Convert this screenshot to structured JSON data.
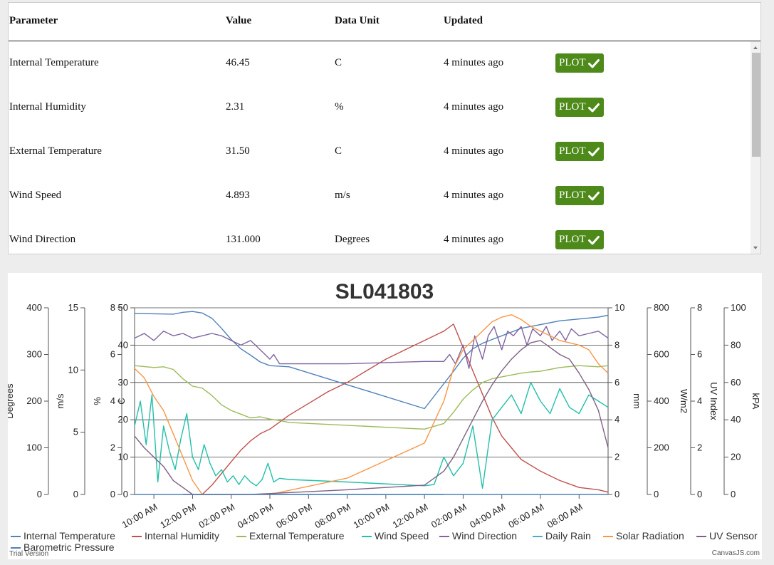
{
  "table": {
    "headers": [
      "Parameter",
      "Value",
      "Data Unit",
      "Updated"
    ],
    "button_label": "PLOT",
    "button_color": "#4e8a1a",
    "button_icon": "check-icon",
    "rows": [
      {
        "parameter": "Internal Temperature",
        "value": "46.45",
        "unit": "C",
        "updated": "4 minutes ago"
      },
      {
        "parameter": "Internal Humidity",
        "value": "2.31",
        "unit": "%",
        "updated": "4 minutes ago"
      },
      {
        "parameter": "External Temperature",
        "value": "31.50",
        "unit": "C",
        "updated": "4 minutes ago"
      },
      {
        "parameter": "Wind Speed",
        "value": "4.893",
        "unit": "m/s",
        "updated": "4 minutes ago"
      },
      {
        "parameter": "Wind Direction",
        "value": "131.000",
        "unit": "Degrees",
        "updated": "4 minutes ago"
      }
    ]
  },
  "chart_data": {
    "type": "line",
    "title": "SL041803",
    "credit": "CanvasJS.com",
    "trial": "Trial Version",
    "grid": true,
    "legend_position": "bottom",
    "x_ticks": [
      "10:00 AM",
      "12:00 PM",
      "02:00 PM",
      "04:00 PM",
      "06:00 PM",
      "08:00 PM",
      "10:00 PM",
      "12:00 AM",
      "02:00 AM",
      "04:00 AM",
      "06:00 AM",
      "08:00 AM"
    ],
    "x_range": [
      9.0,
      33.5
    ],
    "axes": [
      {
        "id": "deg",
        "side": "left",
        "title": "Degrees",
        "min": 0,
        "max": 400,
        "ticks": [
          0,
          100,
          200,
          300,
          400
        ]
      },
      {
        "id": "ms",
        "side": "left",
        "title": "m/s",
        "min": 0,
        "max": 15,
        "ticks": [
          0,
          5,
          10,
          15
        ]
      },
      {
        "id": "pct",
        "side": "left",
        "title": "%",
        "min": 0,
        "max": 8,
        "ticks": [
          0,
          2,
          4,
          6,
          8
        ]
      },
      {
        "id": "c",
        "side": "left",
        "title": "C",
        "min": 0,
        "max": 50,
        "ticks": [
          0,
          10,
          20,
          30,
          40,
          50
        ]
      },
      {
        "id": "mm",
        "side": "right",
        "title": "mm",
        "min": 0,
        "max": 10,
        "ticks": [
          0,
          2,
          4,
          6,
          8,
          10
        ]
      },
      {
        "id": "wm2",
        "side": "right",
        "title": "W/m2",
        "min": 0,
        "max": 800,
        "ticks": [
          0,
          200,
          400,
          600,
          800
        ]
      },
      {
        "id": "uv",
        "side": "right",
        "title": "UV Index",
        "min": 0,
        "max": 8,
        "ticks": [
          0,
          2,
          4,
          6,
          8
        ]
      },
      {
        "id": "kpa",
        "side": "right",
        "title": "kPA",
        "min": 0,
        "max": 100,
        "ticks": [
          0,
          20,
          40,
          60,
          80,
          100
        ]
      }
    ],
    "series": [
      {
        "name": "Internal Temperature",
        "axis": "c",
        "color": "#4f81bc",
        "x": [
          9.0,
          10.0,
          11.0,
          11.5,
          12.0,
          12.5,
          13.0,
          13.5,
          14.0,
          14.5,
          15.0,
          15.5,
          16.0,
          17.0,
          24.0,
          25.5,
          26.0,
          26.5,
          27.0,
          27.5,
          28.0,
          28.5,
          29.0,
          30.0,
          31.0,
          32.0,
          33.0,
          33.5
        ],
        "y": [
          48.5,
          48.4,
          48.3,
          48.8,
          49.0,
          48.6,
          47.2,
          44.5,
          41.5,
          39.0,
          37.3,
          35.5,
          34.5,
          34.2,
          23.0,
          33.0,
          36.5,
          39.0,
          40.5,
          41.5,
          42.5,
          43.5,
          44.5,
          45.5,
          46.5,
          47.0,
          47.5,
          48.0
        ]
      },
      {
        "name": "Internal Humidity",
        "axis": "pct",
        "color": "#c0504e",
        "x": [
          11.5,
          12.0,
          12.5,
          13.0,
          13.5,
          14.0,
          14.5,
          15.0,
          15.5,
          16.0,
          17.0,
          18.0,
          19.0,
          20.0,
          21.0,
          22.0,
          23.0,
          24.0,
          25.0,
          25.5,
          26.0,
          26.5,
          27.0,
          27.5,
          28.0,
          28.5,
          29.0,
          30.0,
          31.0,
          32.0,
          33.0,
          33.5
        ],
        "y": [
          0.0,
          0.0,
          0.0,
          0.4,
          0.9,
          1.4,
          1.9,
          2.3,
          2.6,
          2.8,
          3.4,
          3.9,
          4.4,
          4.8,
          5.3,
          5.8,
          6.2,
          6.6,
          7.0,
          7.3,
          6.3,
          5.3,
          4.3,
          3.3,
          2.5,
          2.0,
          1.5,
          1.0,
          0.6,
          0.3,
          0.2,
          0.1
        ]
      },
      {
        "name": "External Temperature",
        "axis": "c",
        "color": "#9bbb58",
        "x": [
          9.0,
          10.0,
          10.5,
          11.0,
          11.5,
          12.0,
          12.5,
          13.0,
          13.5,
          14.0,
          14.5,
          15.0,
          15.5,
          16.0,
          16.5,
          17.0,
          22.0,
          24.0,
          25.0,
          25.5,
          26.0,
          26.5,
          27.0,
          27.5,
          28.0,
          28.5,
          29.0,
          29.5,
          30.0,
          31.0,
          32.0,
          33.0,
          33.5
        ],
        "y": [
          34.5,
          34.0,
          34.2,
          33.5,
          31.0,
          29.0,
          28.5,
          26.5,
          24.0,
          22.5,
          21.5,
          20.5,
          20.8,
          20.2,
          19.8,
          19.3,
          18.0,
          17.5,
          19.0,
          22.0,
          25.5,
          28.0,
          30.0,
          31.0,
          31.5,
          32.0,
          32.5,
          32.8,
          33.0,
          34.0,
          34.5,
          34.2,
          34.5
        ]
      },
      {
        "name": "Wind Speed",
        "axis": "ms",
        "color": "#23bfaa",
        "x": [
          9.0,
          9.3,
          9.6,
          9.9,
          10.2,
          10.5,
          10.8,
          11.1,
          11.4,
          11.7,
          12.0,
          12.3,
          12.6,
          12.9,
          13.2,
          13.5,
          13.8,
          14.1,
          14.4,
          14.7,
          15.0,
          15.3,
          15.6,
          15.9,
          16.2,
          16.5,
          17.0,
          20.0,
          24.0,
          24.5,
          25.0,
          25.5,
          26.0,
          26.5,
          27.0,
          27.5,
          28.0,
          28.5,
          29.0,
          29.5,
          30.0,
          30.5,
          31.0,
          31.5,
          32.0,
          32.5,
          33.0,
          33.5
        ],
        "y": [
          5.5,
          7.5,
          4.0,
          8.0,
          1.0,
          5.5,
          3.5,
          2.0,
          4.5,
          6.5,
          3.0,
          2.0,
          4.0,
          2.5,
          1.5,
          2.0,
          1.0,
          1.5,
          0.8,
          1.5,
          1.0,
          0.7,
          1.2,
          2.5,
          1.0,
          1.3,
          1.2,
          1.0,
          0.7,
          0.8,
          3.0,
          1.5,
          2.5,
          5.5,
          0.5,
          6.0,
          7.0,
          8.0,
          6.5,
          9.0,
          7.5,
          6.5,
          8.5,
          7.0,
          6.5,
          8.0,
          7.5,
          7.0
        ]
      },
      {
        "name": "Wind Direction",
        "axis": "deg",
        "color": "#8064a1",
        "x": [
          9.0,
          9.5,
          10.0,
          10.5,
          11.0,
          11.5,
          12.0,
          12.5,
          13.0,
          13.5,
          14.0,
          14.5,
          15.0,
          15.5,
          16.0,
          16.2,
          16.5,
          20.0,
          24.0,
          25.0,
          25.3,
          25.6,
          26.0,
          26.3,
          26.6,
          27.0,
          27.3,
          27.6,
          28.0,
          28.3,
          28.6,
          29.0,
          29.3,
          29.6,
          30.0,
          30.3,
          30.6,
          31.0,
          31.3,
          31.6,
          32.0,
          32.5,
          33.0,
          33.5
        ],
        "y": [
          335,
          345,
          330,
          350,
          340,
          345,
          335,
          340,
          345,
          340,
          330,
          320,
          330,
          310,
          290,
          300,
          280,
          280,
          285,
          285,
          300,
          280,
          320,
          270,
          340,
          290,
          340,
          360,
          310,
          350,
          340,
          360,
          320,
          355,
          340,
          360,
          330,
          350,
          330,
          355,
          340,
          345,
          350,
          335
        ]
      },
      {
        "name": "Daily Rain",
        "axis": "mm",
        "color": "#4aacc5",
        "x": [
          16.0,
          20.0,
          25.0
        ],
        "y": [
          0,
          0,
          0
        ]
      },
      {
        "name": "Solar Radiation",
        "axis": "wm2",
        "color": "#f79647",
        "x": [
          9.0,
          9.5,
          10.0,
          10.5,
          11.0,
          11.5,
          12.0,
          12.5,
          13.0,
          16.0,
          20.0,
          24.0,
          25.0,
          25.5,
          26.0,
          26.5,
          27.0,
          27.5,
          28.0,
          28.5,
          29.0,
          29.5,
          30.0,
          30.5,
          31.0,
          31.5,
          32.0,
          32.5,
          33.0,
          33.5
        ],
        "y": [
          540,
          500,
          420,
          360,
          260,
          160,
          60,
          0,
          0,
          0,
          70,
          220,
          400,
          540,
          620,
          660,
          700,
          740,
          760,
          770,
          750,
          720,
          700,
          680,
          660,
          650,
          640,
          620,
          560,
          520
        ]
      },
      {
        "name": "UV Sensor",
        "axis": "uv",
        "color": "#7f6084",
        "x": [
          9.0,
          9.5,
          10.0,
          10.5,
          11.0,
          11.5,
          12.0,
          15.0,
          20.0,
          24.0,
          25.0,
          25.5,
          26.0,
          26.5,
          27.0,
          27.5,
          28.0,
          28.5,
          29.0,
          29.5,
          30.0,
          30.5,
          31.0,
          31.5,
          32.0,
          32.5,
          33.0,
          33.5
        ],
        "y": [
          2.5,
          2.0,
          1.6,
          1.2,
          0.6,
          0.3,
          0.0,
          0.0,
          0.2,
          0.4,
          1.0,
          1.6,
          2.4,
          3.2,
          4.0,
          4.7,
          5.3,
          5.8,
          6.2,
          6.5,
          6.6,
          6.3,
          6.0,
          5.8,
          5.2,
          4.5,
          3.6,
          2.0
        ]
      },
      {
        "name": "Barometric Pressure",
        "axis": "kpa",
        "color": "#4e81bc",
        "x": [
          9.0,
          33.5
        ],
        "y": [
          0,
          0
        ]
      }
    ]
  }
}
